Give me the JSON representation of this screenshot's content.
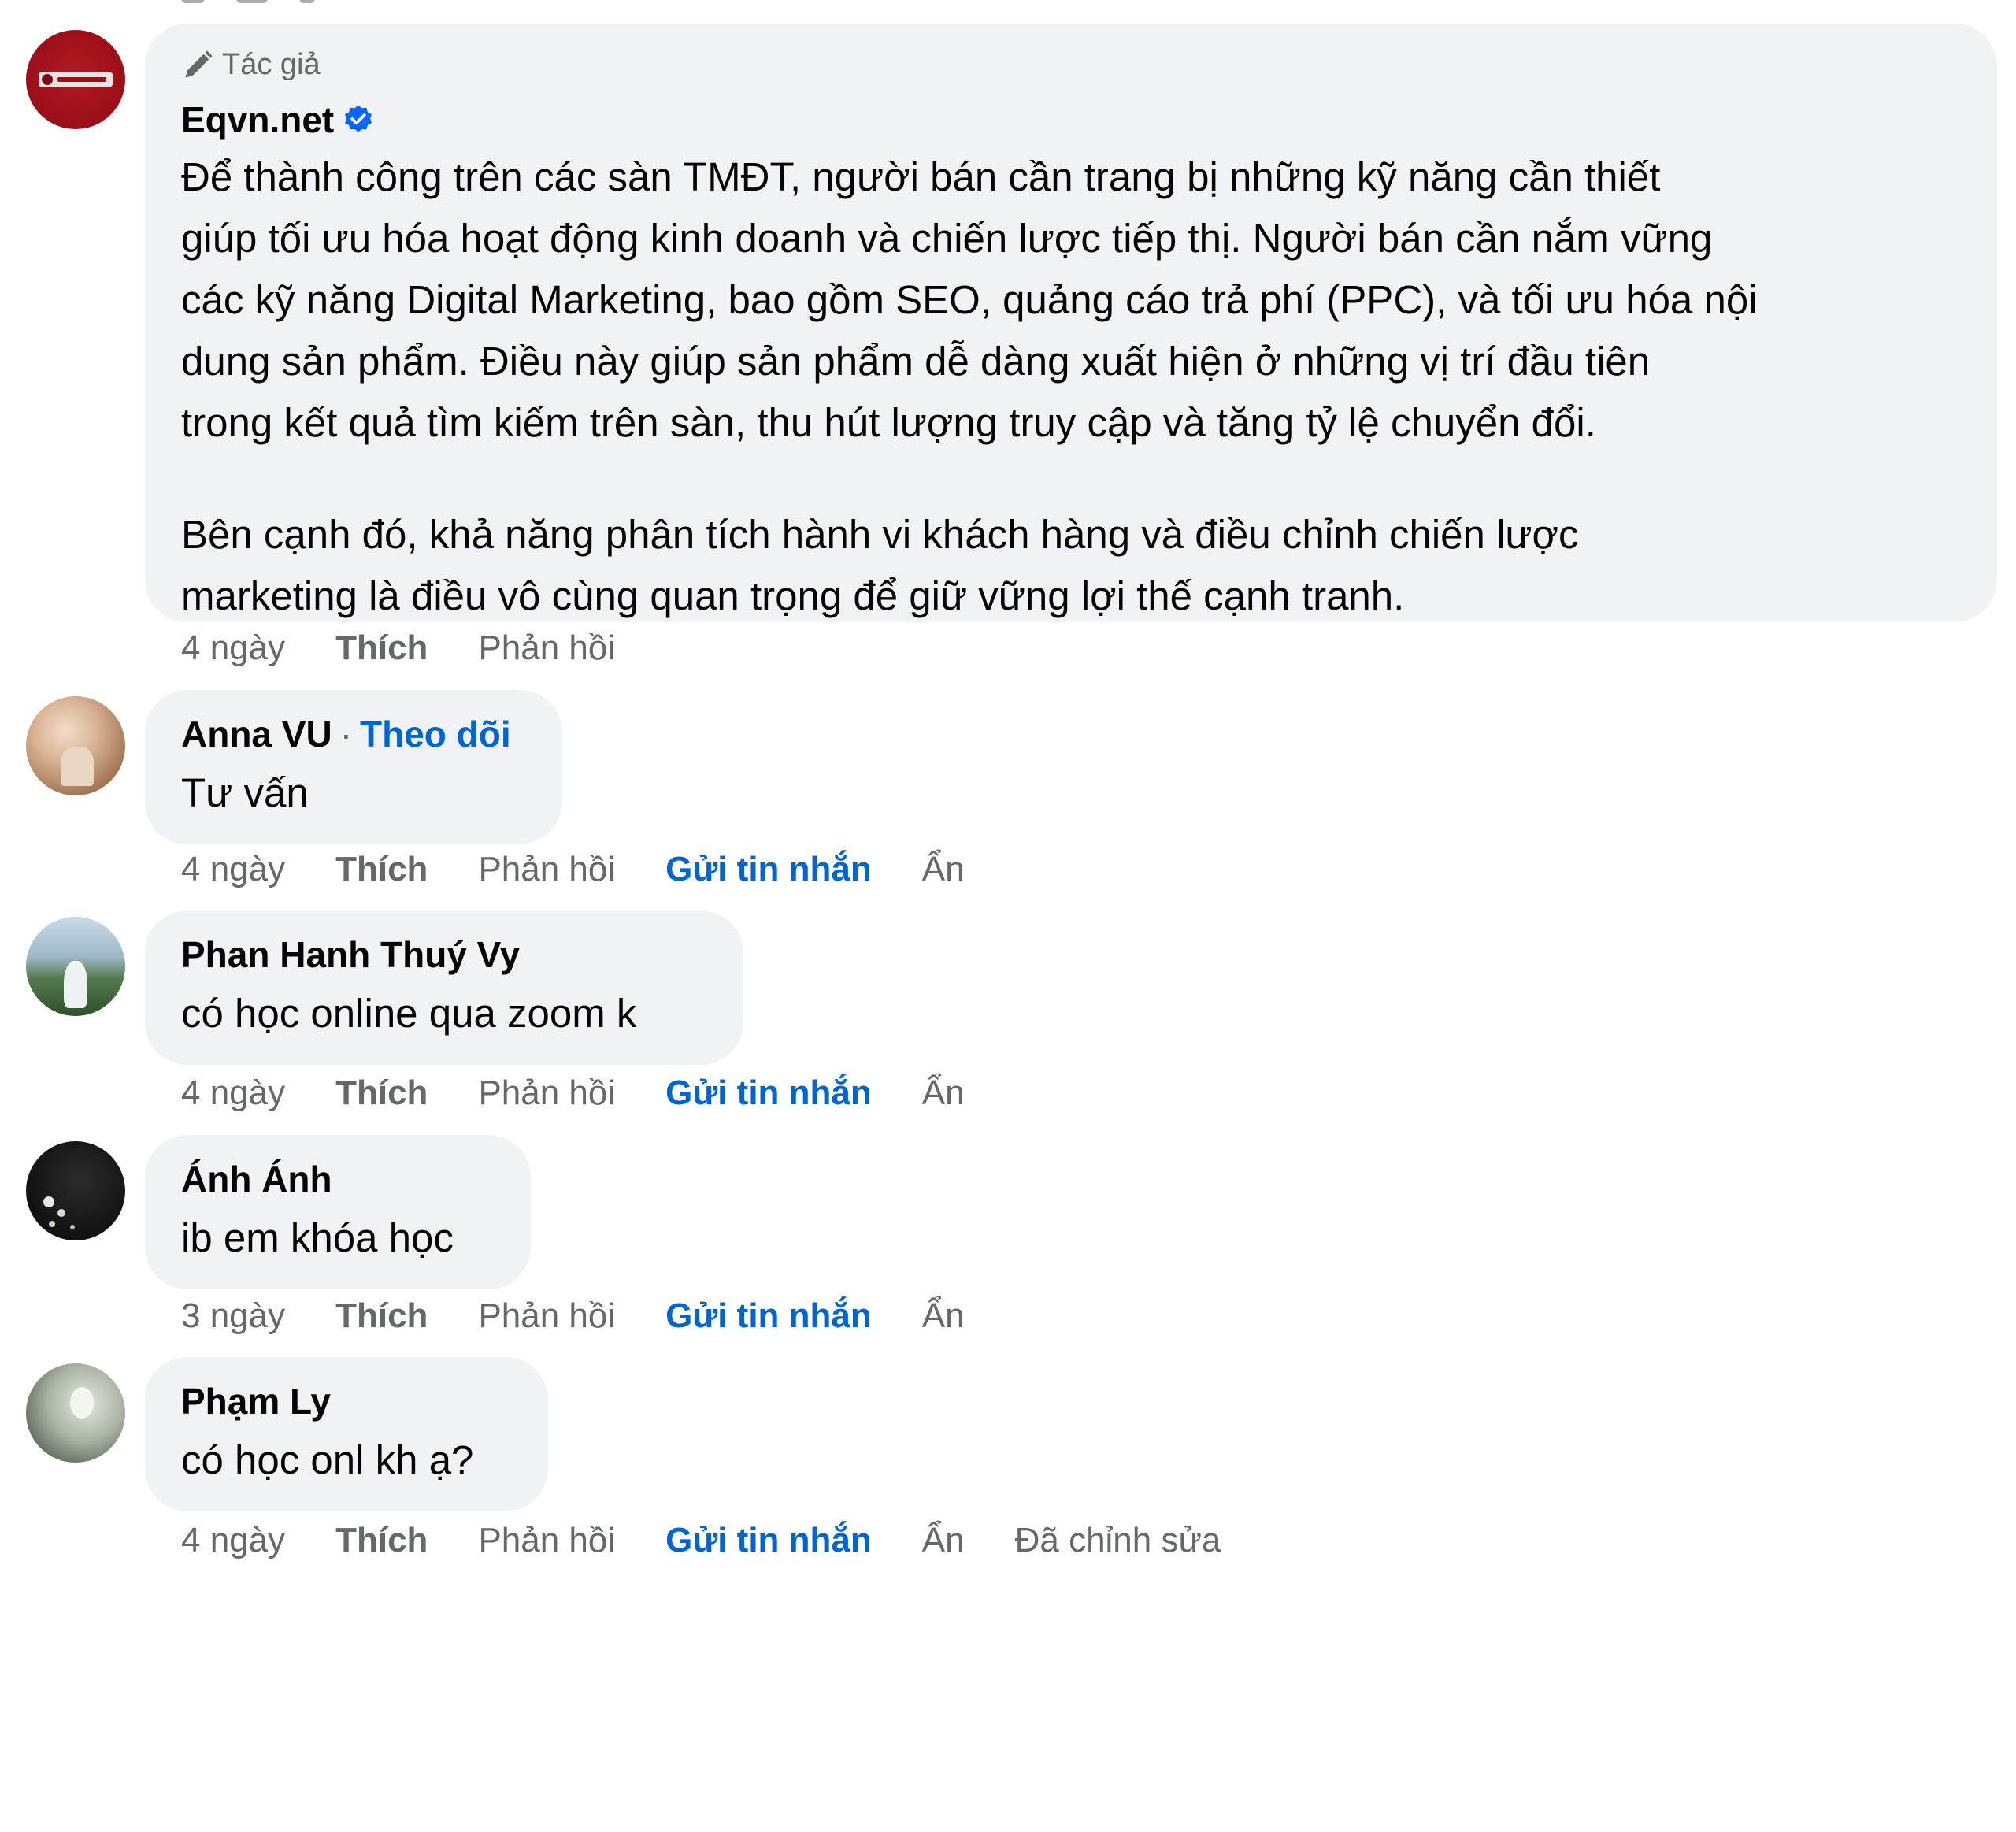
{
  "colors": {
    "bubble_bg": "#f0f2f5",
    "link_blue": "#0064d1",
    "meta_gray": "#65676b",
    "text": "#050505",
    "verified_badge": "#0866ff"
  },
  "comments": [
    {
      "avatar_icon": "eqvn-logo-avatar",
      "author_badge": "Tác giả",
      "author_badge_icon": "pencil-icon",
      "name": "Eqvn.net",
      "verified": true,
      "paragraphs": [
        [
          "Để thành công trên các sàn TMĐT, người bán cần trang bị những kỹ năng cần thiết",
          "giúp tối ưu hóa hoạt động kinh doanh và chiến lược tiếp thị. Người bán cần nắm vững",
          "các kỹ năng Digital Marketing, bao gồm SEO, quảng cáo trả phí (PPC), và tối ưu hóa nội",
          "dung sản phẩm. Điều này giúp sản phẩm dễ dàng xuất hiện ở những vị trí đầu tiên",
          "trong kết quả tìm kiếm trên sàn, thu hút lượng truy cập và tăng tỷ lệ chuyển đổi."
        ],
        [
          "Bên cạnh đó, khả năng phân tích hành vi khách hàng và điều chỉnh chiến lược",
          "marketing là điều vô cùng quan trọng để giữ vững lợi thế cạnh tranh."
        ]
      ],
      "time": "4 ngày",
      "like": "Thích",
      "reply": "Phản hồi"
    },
    {
      "avatar_icon": "user-avatar",
      "name": "Anna VU",
      "separator": "·",
      "follow": "Theo dõi",
      "text": "Tư vấn",
      "time": "4 ngày",
      "like": "Thích",
      "reply": "Phản hồi",
      "message": "Gửi tin nhắn",
      "hide": "Ẩn"
    },
    {
      "avatar_icon": "user-avatar",
      "name": "Phan Hanh Thuý Vy",
      "text": "có học online qua zoom k",
      "time": "4 ngày",
      "like": "Thích",
      "reply": "Phản hồi",
      "message": "Gửi tin nhắn",
      "hide": "Ẩn"
    },
    {
      "avatar_icon": "user-avatar",
      "name": "Ánh Ánh",
      "text": "ib em khóa học",
      "time": "3 ngày",
      "like": "Thích",
      "reply": "Phản hồi",
      "message": "Gửi tin nhắn",
      "hide": "Ẩn"
    },
    {
      "avatar_icon": "user-avatar",
      "name": "Phạm Ly",
      "text": "có học onl kh ạ?",
      "time": "4 ngày",
      "like": "Thích",
      "reply": "Phản hồi",
      "message": "Gửi tin nhắn",
      "hide": "Ẩn",
      "edited": "Đã chỉnh sửa"
    }
  ]
}
